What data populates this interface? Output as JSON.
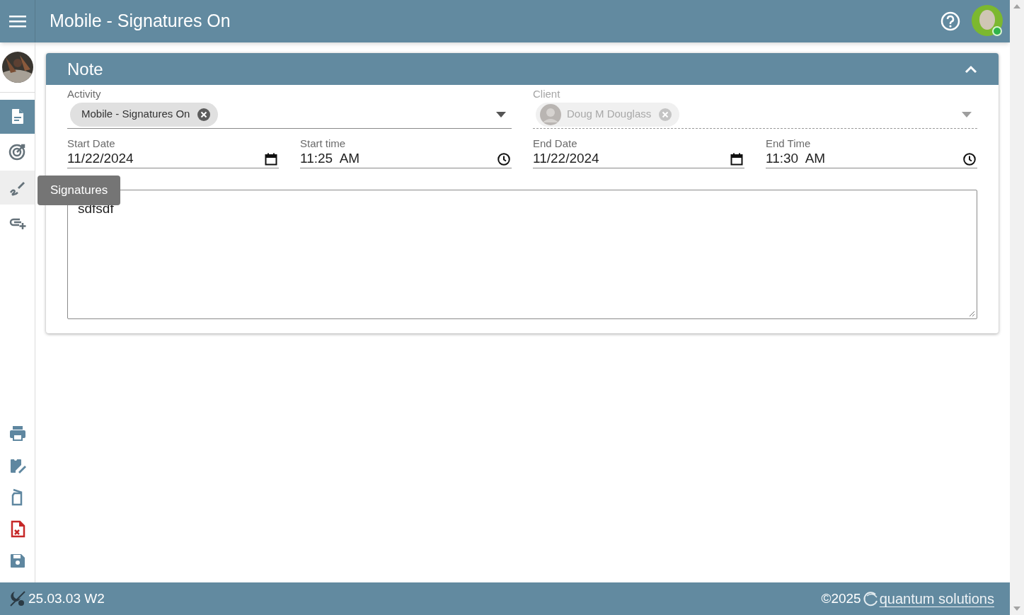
{
  "header": {
    "title": "Mobile - Signatures On"
  },
  "sidebar": {
    "items": [
      {
        "kind": "document",
        "selected": true,
        "hovered": false
      },
      {
        "kind": "target",
        "selected": false,
        "hovered": false
      },
      {
        "kind": "signature",
        "selected": false,
        "hovered": true
      },
      {
        "kind": "link-add",
        "selected": false,
        "hovered": false
      }
    ],
    "tooltip": "Signatures",
    "tools": [
      {
        "kind": "printer"
      },
      {
        "kind": "clipboard-edit"
      },
      {
        "kind": "file"
      },
      {
        "kind": "file-x"
      },
      {
        "kind": "save"
      }
    ]
  },
  "card": {
    "title": "Note",
    "expanded": true,
    "activity": {
      "label": "Activity",
      "chip": "Mobile - Signatures On",
      "disabled": false
    },
    "client": {
      "label": "Client",
      "chip": "Doug M Douglass",
      "disabled": true
    },
    "dates": [
      {
        "kind": "date",
        "label": "Start Date",
        "value": "11/22/2024"
      },
      {
        "kind": "time",
        "label": "Start time",
        "value": "11:25  AM"
      },
      {
        "kind": "date",
        "label": "End Date",
        "value": "11/22/2024"
      },
      {
        "kind": "time",
        "label": "End Time",
        "value": "11:30  AM"
      }
    ],
    "notes": {
      "value": "sdfsdf"
    }
  },
  "footer": {
    "version": "25.03.03 W2",
    "copyright": "©2025",
    "brand": "quantum solutions"
  }
}
